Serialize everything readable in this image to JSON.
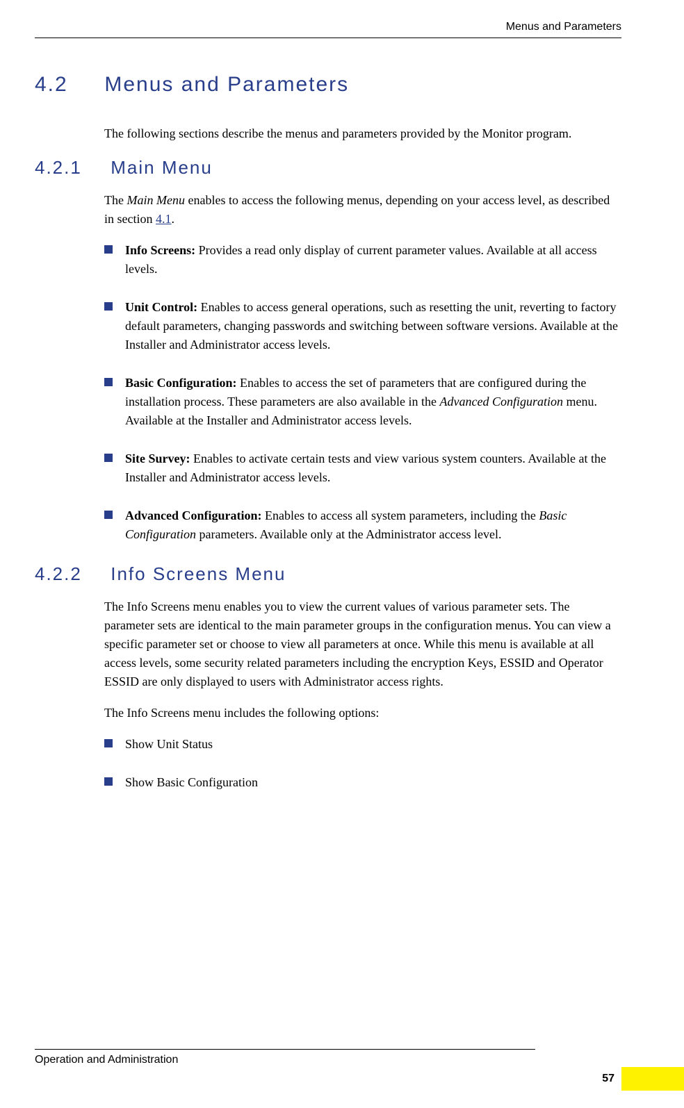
{
  "header": {
    "right": "Menus and Parameters"
  },
  "section42": {
    "num": "4.2",
    "title": "Menus and Parameters",
    "intro": "The following sections describe the menus and parameters provided by the Monitor program."
  },
  "section421": {
    "num": "4.2.1",
    "title": "Main Menu",
    "intro_pre": "The ",
    "intro_em": "Main Menu",
    "intro_post": " enables to access the following menus, depending on your access level, as described in section ",
    "link": "4.1",
    "intro_end": ".",
    "bullets": [
      {
        "bold": "Info Screens:",
        "rest": " Provides a read only display of current parameter values. Available at all access levels."
      },
      {
        "bold": "Unit Control:",
        "rest": " Enables to access general operations, such as resetting the unit, reverting to factory default parameters, changing passwords and switching between software versions. Available at the Installer and Administrator access levels."
      },
      {
        "bold": "Basic Configuration:",
        "rest_pre": " Enables to access the set of parameters that are configured during the installation process. These parameters are also available in the ",
        "rest_em": "Advanced Configuration",
        "rest_post": " menu. Available at the Installer and Administrator access levels."
      },
      {
        "bold": "Site Survey:",
        "rest": " Enables to activate certain tests and view various system counters. Available at the Installer and Administrator access levels."
      },
      {
        "bold": "Advanced Configuration:",
        "rest_pre": " Enables to access all system parameters, including the ",
        "rest_em": "Basic Configuration",
        "rest_post": " parameters. Available only at the Administrator access level."
      }
    ]
  },
  "section422": {
    "num": "4.2.2",
    "title": "Info Screens Menu",
    "para1": "The Info Screens menu enables you to view the current values of various parameter sets. The parameter sets are identical to the main parameter groups in the configuration menus. You can view a specific parameter set or choose to view all parameters at once. While this menu is available at all access levels, some security related parameters including the encryption Keys, ESSID and Operator ESSID are only displayed to users with Administrator access rights.",
    "para2": "The Info Screens menu includes the following options:",
    "bullets": [
      "Show Unit Status",
      "Show Basic Configuration"
    ]
  },
  "footer": {
    "left": "Operation and Administration",
    "page": "57"
  }
}
